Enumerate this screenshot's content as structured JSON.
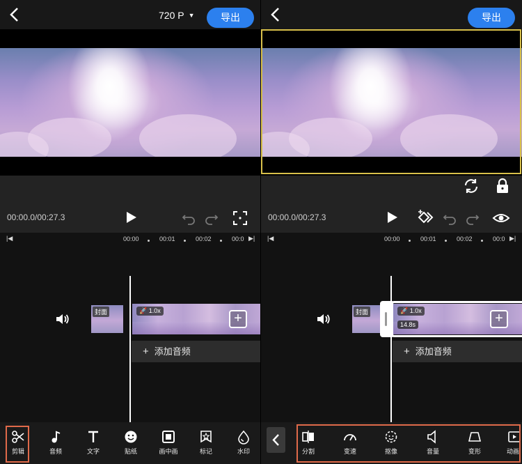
{
  "left": {
    "resolution": "720 P",
    "export_label": "导出",
    "time": "00:00.0/00:27.3",
    "ruler": [
      "00:00",
      "00:01",
      "00:02",
      "00:0"
    ],
    "cover_label": "封面",
    "speed": "1.0x",
    "add_audio": "添加音频",
    "tools": [
      "剪辑",
      "音频",
      "文字",
      "贴纸",
      "画中画",
      "标记",
      "水印"
    ]
  },
  "right": {
    "export_label": "导出",
    "time": "00:00.0/00:27.3",
    "ruler": [
      "00:00",
      "00:01",
      "00:02",
      "00:0"
    ],
    "cover_label": "封面",
    "speed": "1.0x",
    "duration": "14.8s",
    "add_audio": "添加音频",
    "tools": [
      "分割",
      "变速",
      "抠像",
      "音量",
      "变形",
      "动画"
    ]
  },
  "icons": {
    "back": "chevron-left-icon",
    "play": "play-icon",
    "undo": "undo-icon",
    "redo": "redo-icon",
    "fullscreen": "fullscreen-icon",
    "keyframe": "keyframe-icon",
    "eye": "eye-icon",
    "rotate": "rotate-icon",
    "lock": "lock-icon",
    "speaker": "speaker-icon"
  },
  "colors": {
    "accent": "#2c80ee",
    "highlight": "#e06a4a",
    "selection": "#d8c04a"
  }
}
